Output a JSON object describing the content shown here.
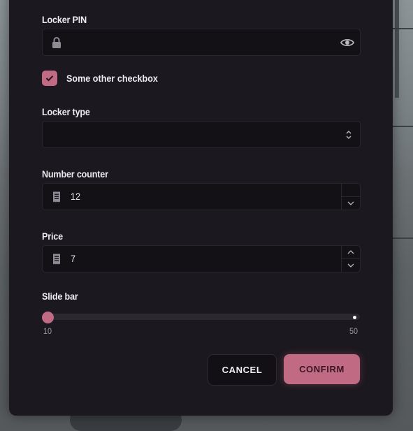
{
  "form": {
    "pin_label": "Locker PIN",
    "pin_value": "",
    "checkbox_label": "Some other checkbox",
    "checkbox_checked": true,
    "type_label": "Locker type",
    "type_value": "",
    "counter_label": "Number counter",
    "counter_value": "12",
    "price_label": "Price",
    "price_value": "7",
    "slider_label": "Slide bar",
    "slider_min": "10",
    "slider_max": "50",
    "slider_value": 10
  },
  "actions": {
    "cancel_label": "CANCEL",
    "confirm_label": "CONFIRM"
  },
  "colors": {
    "accent": "#c06a84",
    "panel": "#1c181f",
    "input": "#141116"
  },
  "icons": {
    "pin": "lock-icon",
    "reveal": "eye-icon",
    "select": "chevron-up-down-icon",
    "counter": "receipt-icon",
    "price": "receipt-icon",
    "stepper_up": "chevron-up-icon",
    "stepper_down": "chevron-down-icon",
    "check": "check-icon"
  }
}
